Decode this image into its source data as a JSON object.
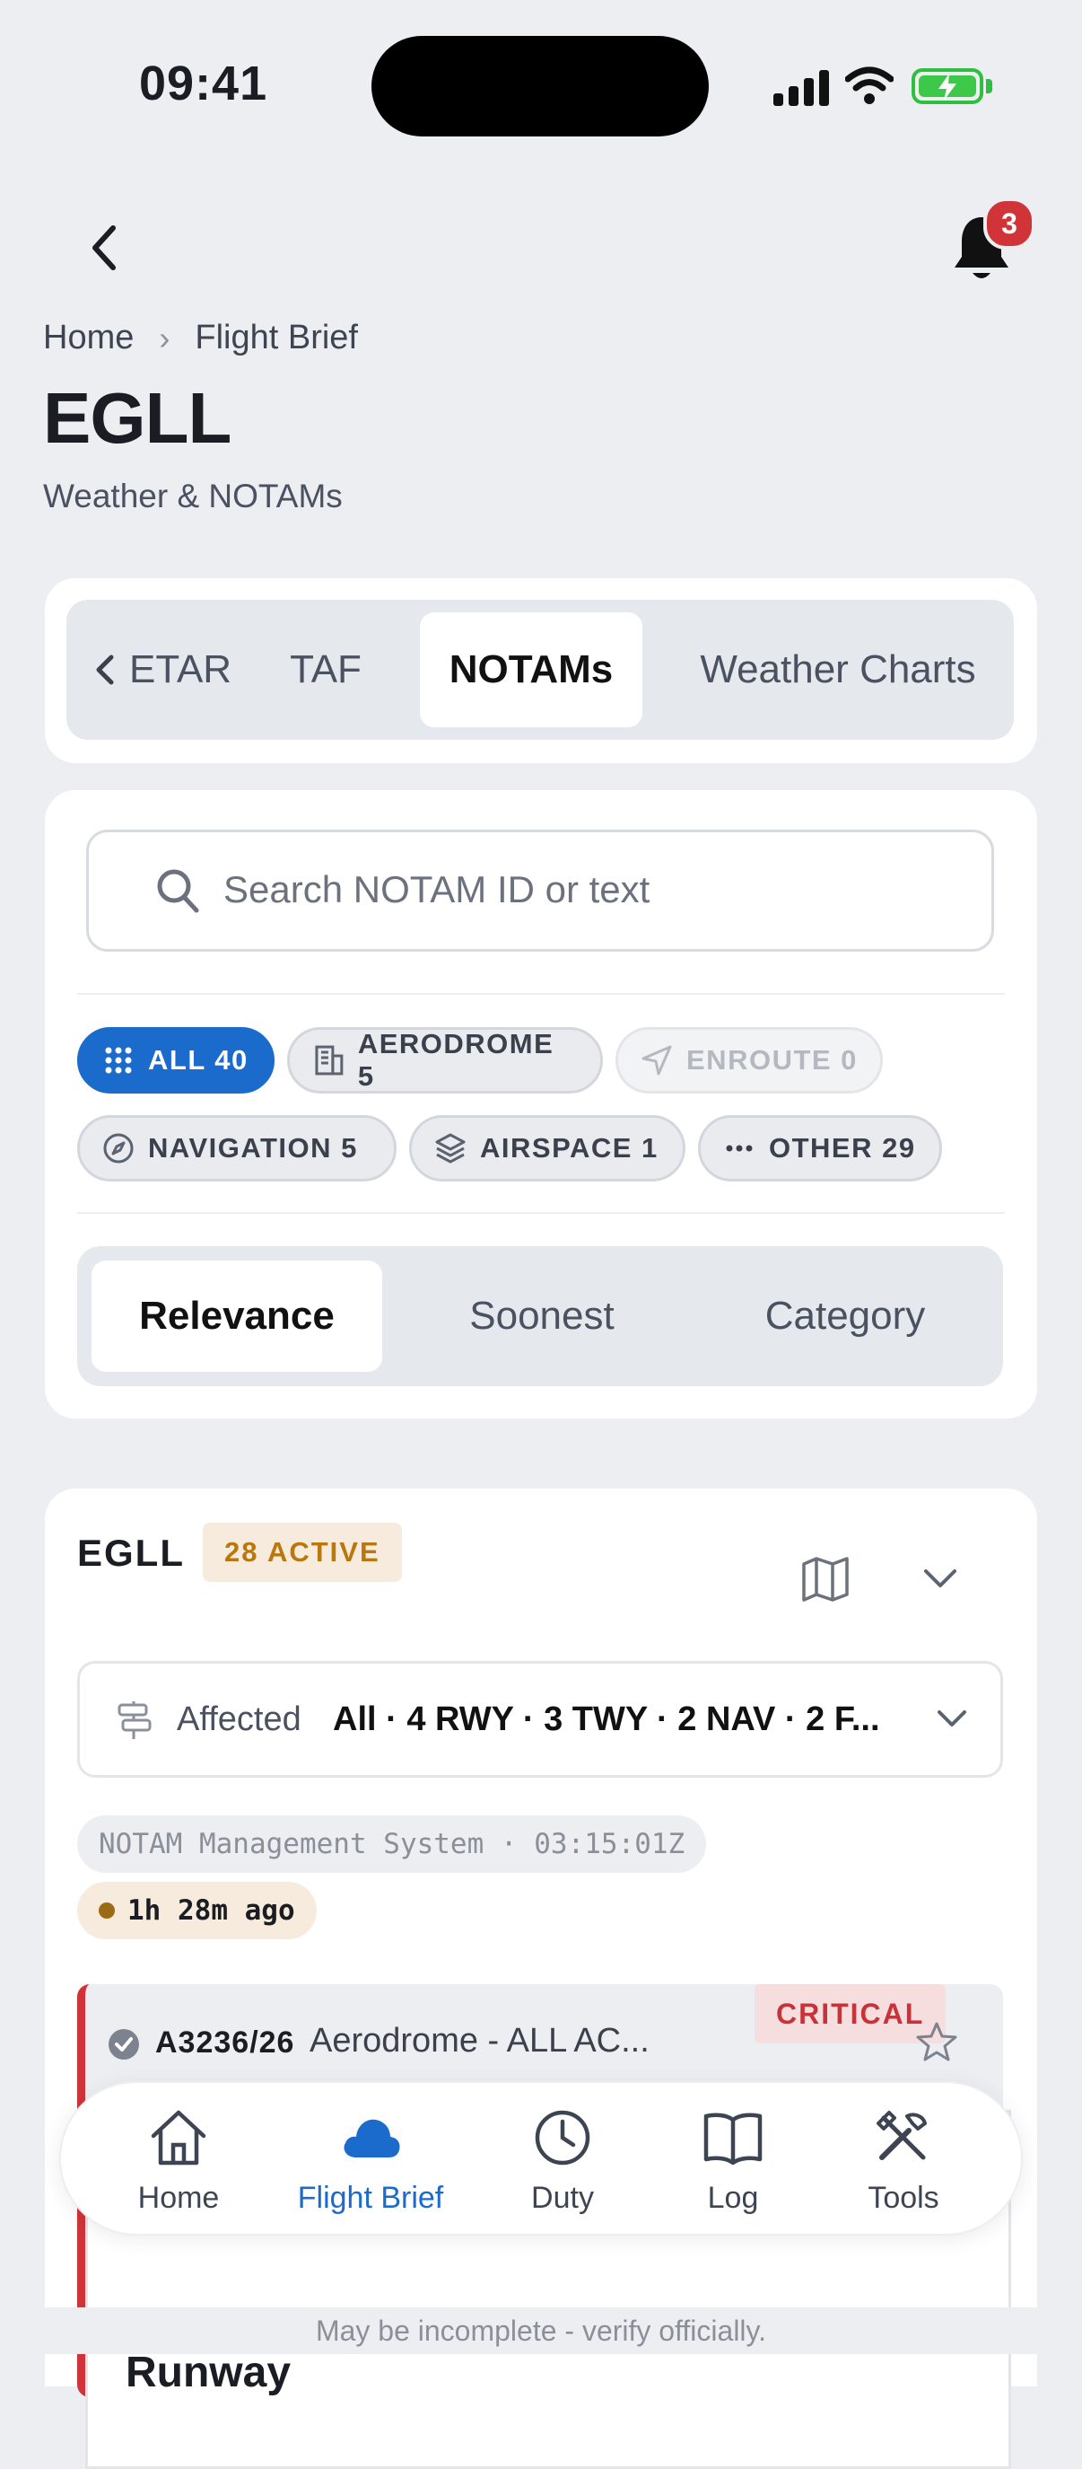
{
  "status_bar": {
    "time": "09:41"
  },
  "header": {
    "notification_count": "3"
  },
  "breadcrumb": {
    "home": "Home",
    "current": "Flight Brief"
  },
  "page": {
    "title": "EGLL",
    "subtitle": "Weather & NOTAMs"
  },
  "tabs": [
    {
      "label": "ETAR"
    },
    {
      "label": "TAF"
    },
    {
      "label": "NOTAMs",
      "active": true
    },
    {
      "label": "Weather Charts"
    }
  ],
  "search": {
    "placeholder": "Search NOTAM ID or text"
  },
  "filters": [
    {
      "label": "ALL 40",
      "icon": "grid-icon",
      "state": "active"
    },
    {
      "label": "AERODROME 5",
      "icon": "building-icon"
    },
    {
      "label": "ENROUTE 0",
      "icon": "navigation-arrow-icon",
      "state": "disabled"
    },
    {
      "label": "NAVIGATION 5",
      "icon": "compass-icon"
    },
    {
      "label": "AIRSPACE 1",
      "icon": "layers-icon"
    },
    {
      "label": "OTHER 29",
      "icon": "more-icon"
    }
  ],
  "sort": [
    {
      "label": "Relevance",
      "active": true
    },
    {
      "label": "Soonest"
    },
    {
      "label": "Category"
    }
  ],
  "airport_group": {
    "code": "EGLL",
    "active_badge": "28 ACTIVE",
    "affected_label": "Affected",
    "affected_value": "All · 4 RWY · 3 TWY · 2 NAV · 2 F...",
    "source": "NOTAM Management System · 03:15:01Z",
    "age": "1h 28m ago"
  },
  "notam": {
    "id": "A3236/26",
    "summary": "Aerodrome - ALL AC...",
    "severity": "CRITICAL",
    "section": "Runway"
  },
  "bottom_nav": [
    {
      "label": "Home",
      "icon": "home-icon"
    },
    {
      "label": "Flight Brief",
      "icon": "cloud-icon",
      "active": true
    },
    {
      "label": "Duty",
      "icon": "clock-icon"
    },
    {
      "label": "Log",
      "icon": "book-icon"
    },
    {
      "label": "Tools",
      "icon": "tools-icon"
    }
  ],
  "footer": {
    "disclaimer": "May be incomplete - verify officially."
  },
  "colors": {
    "accent": "#1a6bcc",
    "critical": "#d13438",
    "warning_bg": "#f6ebdc",
    "warning_text": "#b9770e"
  }
}
